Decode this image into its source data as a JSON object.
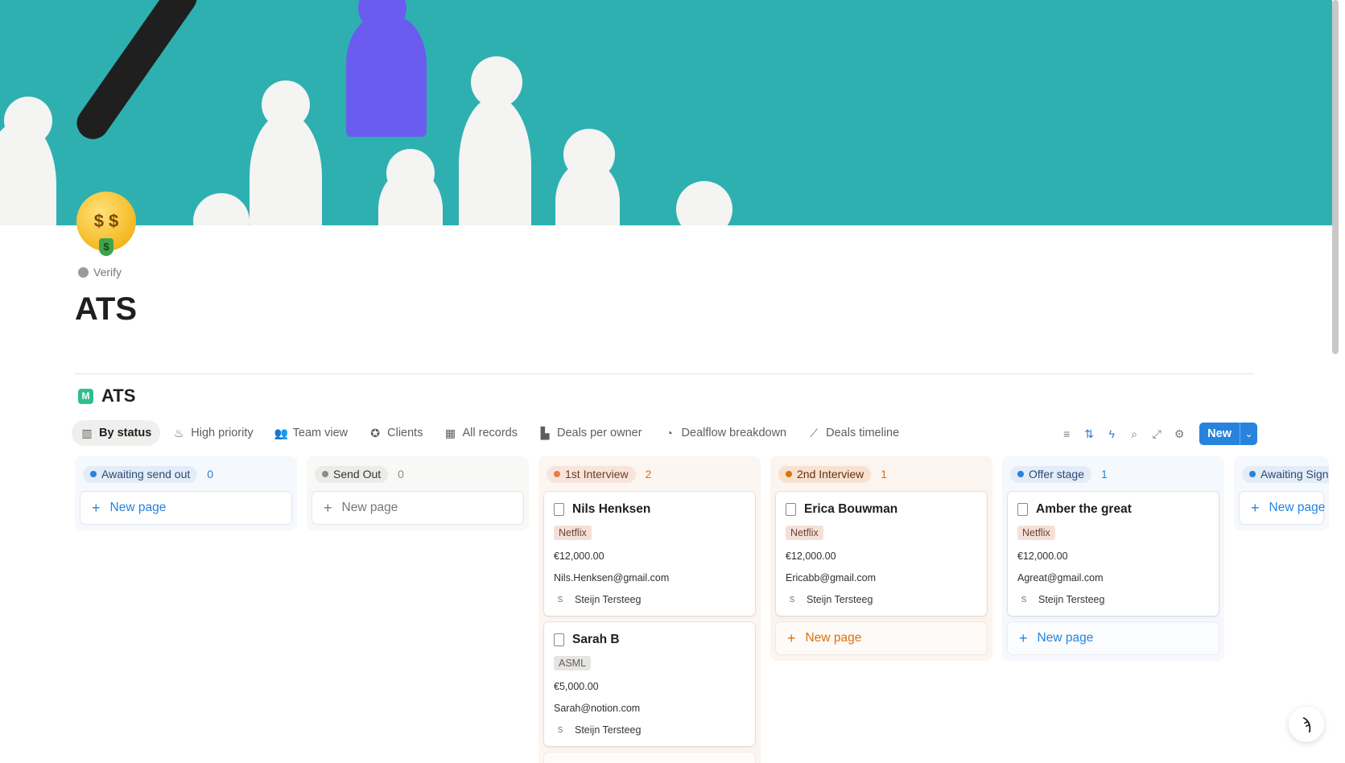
{
  "page": {
    "verify_label": "Verify",
    "title": "ATS",
    "icon": "money-mouth-face-emoji"
  },
  "database": {
    "title": "ATS",
    "icon": "database-icon"
  },
  "tabs": [
    {
      "label": "By status",
      "icon": "board-icon",
      "active": true
    },
    {
      "label": "High priority",
      "icon": "fire-icon",
      "active": false
    },
    {
      "label": "Team view",
      "icon": "people-icon",
      "active": false
    },
    {
      "label": "Clients",
      "icon": "star-circle-icon",
      "active": false
    },
    {
      "label": "All records",
      "icon": "grid-icon",
      "active": false
    },
    {
      "label": "Deals per owner",
      "icon": "bar-chart-icon",
      "active": false
    },
    {
      "label": "Dealflow breakdown",
      "icon": "pie-chart-icon",
      "active": false
    },
    {
      "label": "Deals timeline",
      "icon": "line-chart-icon",
      "active": false
    }
  ],
  "toolbar": {
    "new_label": "New",
    "tools": [
      "filter-icon",
      "sort-icon",
      "lightning-icon",
      "search-icon",
      "expand-icon",
      "settings-icon"
    ]
  },
  "new_page_label": "New page",
  "columns": [
    {
      "status": "Awaiting send out",
      "count": "0",
      "color": "#2783de",
      "bg": "#f5f8fc",
      "pill_bg": "#e3ecf7",
      "text": "#2b4a75",
      "count_color": "#2783de",
      "cards": []
    },
    {
      "status": "Send Out",
      "count": "0",
      "color": "#8c8b88",
      "bg": "#f8f8f7",
      "pill_bg": "#ebebea",
      "text": "#37352f",
      "count_color": "#8c8b88",
      "cards": []
    },
    {
      "status": "1st Interview",
      "count": "2",
      "color": "#e87a4c",
      "bg": "#fcf6f3",
      "pill_bg": "#f8e4da",
      "text": "#6b3e25",
      "count_color": "#d9730d",
      "cards": [
        {
          "name": "Nils Henksen",
          "company": "Netflix",
          "amount": "€12,000.00",
          "email": "Nils.Henksen@gmail.com",
          "owner_initial": "S",
          "owner": "Steijn Tersteeg"
        },
        {
          "name": "Sarah B",
          "company": "ASML",
          "amount": "€5,000.00",
          "email": "Sarah@notion.com",
          "owner_initial": "S",
          "owner": "Steijn Tersteeg"
        }
      ]
    },
    {
      "status": "2nd Interview",
      "count": "1",
      "color": "#d9730d",
      "bg": "#fcf4ee",
      "pill_bg": "#f9e1cf",
      "text": "#5e3313",
      "count_color": "#d9730d",
      "cards": [
        {
          "name": "Erica Bouwman",
          "company": "Netflix",
          "amount": "€12,000.00",
          "email": "Ericabb@gmail.com",
          "owner_initial": "S",
          "owner": "Steijn Tersteeg"
        }
      ]
    },
    {
      "status": "Offer stage",
      "count": "1",
      "color": "#2783de",
      "bg": "#f5f8fc",
      "pill_bg": "#e3ecf7",
      "text": "#2b4a75",
      "count_color": "#2783de",
      "cards": [
        {
          "name": "Amber the great",
          "company": "Netflix",
          "amount": "€12,000.00",
          "email": "Agreat@gmail.com",
          "owner_initial": "S",
          "owner": "Steijn Tersteeg"
        }
      ]
    },
    {
      "status": "Awaiting Signa",
      "count": "",
      "color": "#2783de",
      "bg": "#f5f8fc",
      "pill_bg": "#e3ecf7",
      "text": "#2b4a75",
      "count_color": "#2783de",
      "cards": []
    }
  ]
}
